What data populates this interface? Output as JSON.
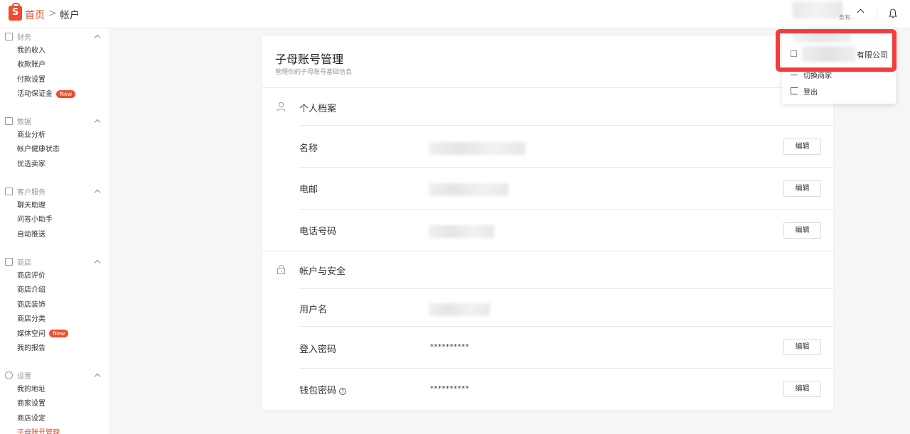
{
  "header": {
    "breadcrumb_home": "首页",
    "breadcrumb_sep": ">",
    "breadcrumb_current": "帐户",
    "shop_short": "务有...",
    "accent": "#ee4d2d"
  },
  "sidebar": {
    "groups": [
      {
        "title": "财务",
        "icon": "wallet-icon",
        "items": [
          {
            "label": "我的收入"
          },
          {
            "label": "收款账户"
          },
          {
            "label": "付款设置"
          },
          {
            "label": "活动保证金",
            "badge": "New"
          }
        ]
      },
      {
        "title": "数据",
        "icon": "chart-icon",
        "items": [
          {
            "label": "商业分析"
          },
          {
            "label": "帐户健康状态"
          },
          {
            "label": "优选卖家"
          }
        ]
      },
      {
        "title": "客户服务",
        "icon": "chat-icon",
        "items": [
          {
            "label": "聊天助理"
          },
          {
            "label": "问答小助手"
          },
          {
            "label": "自动推送"
          }
        ]
      },
      {
        "title": "商店",
        "icon": "store-icon",
        "items": [
          {
            "label": "商店评价"
          },
          {
            "label": "商店介绍"
          },
          {
            "label": "商店装饰"
          },
          {
            "label": "商店分类"
          },
          {
            "label": "媒体空间",
            "badge": "New"
          },
          {
            "label": "我的报告"
          }
        ]
      },
      {
        "title": "设置",
        "icon": "gear-icon",
        "items": [
          {
            "label": "我的地址"
          },
          {
            "label": "商家设置"
          },
          {
            "label": "商店设定"
          },
          {
            "label": "子母账号管理",
            "active": true
          }
        ]
      }
    ]
  },
  "card": {
    "title": "子母账号管理",
    "subtitle": "管理你的子母账号基础信息",
    "profile_section": "个人档案",
    "security_section": "帐户与安全",
    "rows": {
      "name": "名称",
      "email": "电邮",
      "phone": "电话号码",
      "username": "用户名",
      "login_password": "登入密码",
      "wallet_password": "钱包密码"
    },
    "password_mask": "**********",
    "wallet_mask": "**********",
    "edit_label": "编辑",
    "help_glyph": "?"
  },
  "dropdown": {
    "shop_name": "有限公司",
    "switch_label": "切换商家",
    "logout_label": "登出",
    "highlight_color": "#f53b3b"
  }
}
